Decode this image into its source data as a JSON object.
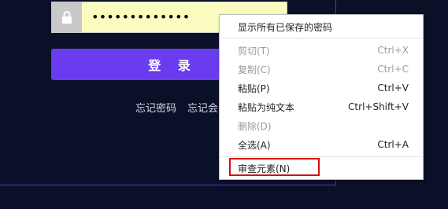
{
  "login": {
    "password_value": "•••••••••••••",
    "lock_icon": "lock-icon",
    "login_button": "登 录",
    "link_forgot_password": "忘记密码",
    "link_forgot_member": "忘记会员"
  },
  "context_menu": {
    "items": [
      {
        "label": "显示所有已保存的密码",
        "shortcut": "",
        "enabled": true
      },
      {
        "label": "剪切(T)",
        "shortcut": "Ctrl+X",
        "enabled": false
      },
      {
        "label": "复制(C)",
        "shortcut": "Ctrl+C",
        "enabled": false
      },
      {
        "label": "粘贴(P)",
        "shortcut": "Ctrl+V",
        "enabled": true
      },
      {
        "label": "粘贴为纯文本",
        "shortcut": "Ctrl+Shift+V",
        "enabled": true
      },
      {
        "label": "删除(D)",
        "shortcut": "",
        "enabled": false
      },
      {
        "label": "全选(A)",
        "shortcut": "Ctrl+A",
        "enabled": true
      },
      {
        "label": "审查元素(N)",
        "shortcut": "",
        "enabled": true
      }
    ]
  },
  "colors": {
    "background": "#0b1029",
    "accent": "#6a3cf0",
    "highlight": "#d40f0f",
    "autofill": "#fbfdc0"
  }
}
